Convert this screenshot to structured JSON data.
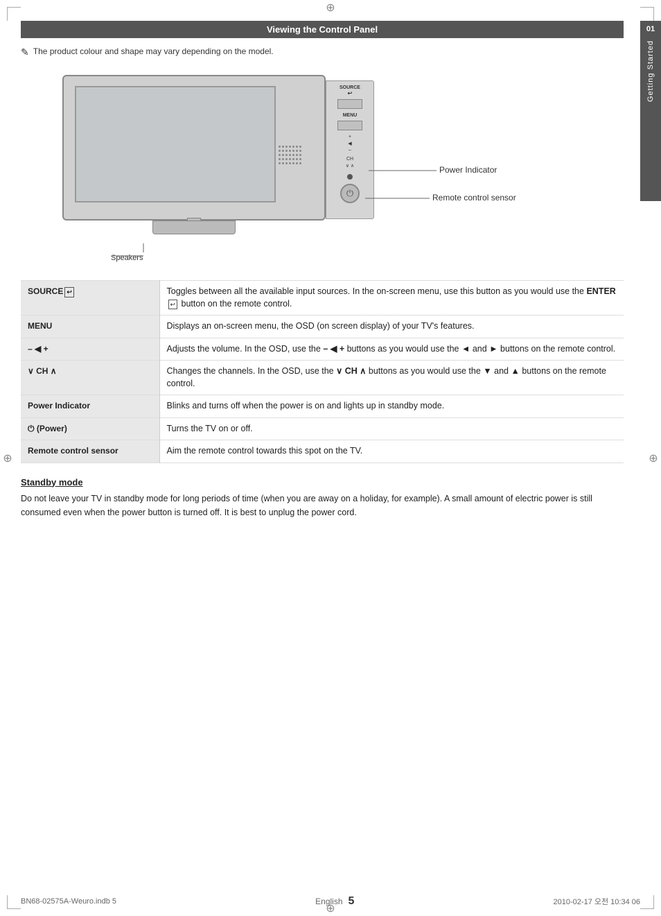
{
  "page": {
    "title": "Viewing the Control Panel",
    "note": "The product colour and shape may vary depending on the model.",
    "sidebar": {
      "number": "01",
      "label": "Getting Started"
    },
    "diagram": {
      "power_indicator_label": "Power Indicator",
      "remote_sensor_label": "Remote control sensor",
      "speakers_label": "Speakers",
      "controls": {
        "source": "SOURCE",
        "menu": "MENU",
        "volume": "– ◀ +",
        "channel": "∨ CH ∧",
        "power": "⏻"
      }
    },
    "features": [
      {
        "name": "SOURCE",
        "description": "Toggles between all the available input sources. In the on-screen menu, use this button as you would use the ENTER button on the remote control."
      },
      {
        "name": "MENU",
        "description": "Displays an on-screen menu, the OSD (on screen display) of your TV's features."
      },
      {
        "name": "– ◀ +",
        "description": "Adjusts the volume. In the OSD, use the – ◀ + buttons as you would use the ◄ and ► buttons on the remote control."
      },
      {
        "name": "∨ CH ∧",
        "description": "Changes the channels. In the OSD, use the ∨ CH ∧ buttons as you would use the ▼ and ▲ buttons on the remote control."
      },
      {
        "name": "Power Indicator",
        "description": "Blinks and turns off when the power is on and lights up in standby mode."
      },
      {
        "name": "⏻ (Power)",
        "description": "Turns the TV on or off."
      },
      {
        "name": "Remote control sensor",
        "description": "Aim the remote control towards this spot on the TV."
      }
    ],
    "standby": {
      "title": "Standby mode",
      "text": "Do not leave your TV in standby mode for long periods of time (when you are away on a holiday, for example). A small amount of electric power is still consumed even when the power button is turned off. It is best to unplug the power cord."
    },
    "footer": {
      "filename": "BN68-02575A-Weuro.indb   5",
      "page_label": "English",
      "page_number": "5",
      "date": "2010-02-17   오전 10:34   06"
    }
  }
}
